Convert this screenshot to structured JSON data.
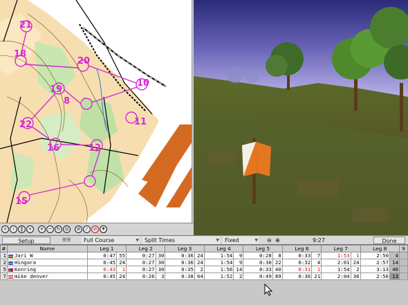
{
  "toolbar": {
    "setup_label": "Setup",
    "course_label": "Full Course",
    "split_label": "Split Times",
    "fixed_label": "Fixed",
    "time_display": "9:27",
    "done_label": "Done"
  },
  "map": {
    "control_labels": [
      "21",
      "18",
      "20",
      "10",
      "19",
      "8",
      "11",
      "22",
      "16",
      "12",
      "15"
    ]
  },
  "table": {
    "headers": [
      "#",
      "Name",
      "Leg 1",
      "Leg 2",
      "Leg 3",
      "Leg 4",
      "Leg 5",
      "Leg 6",
      "Leg 7",
      "Leg 8",
      "9"
    ],
    "rows": [
      {
        "rank": "1",
        "flag": "se",
        "name": "Jari W",
        "legs": [
          [
            "0:47",
            "55"
          ],
          [
            "0:27",
            "30"
          ],
          [
            "0:36",
            "24"
          ],
          [
            "1:54",
            "9"
          ],
          [
            "0:28",
            "8"
          ],
          [
            "0:33",
            "7"
          ],
          [
            "1:53",
            "1"
          ],
          [
            "2:50",
            "4"
          ]
        ]
      },
      {
        "rank": "2",
        "flag": "se",
        "name": "Hingara",
        "legs": [
          [
            "0:45",
            "24"
          ],
          [
            "0:27",
            "30"
          ],
          [
            "0:36",
            "24"
          ],
          [
            "1:54",
            "9"
          ],
          [
            "0:30",
            "22"
          ],
          [
            "0:32",
            "4"
          ],
          [
            "2:01",
            "24"
          ],
          [
            "2:57",
            "14"
          ]
        ]
      },
      {
        "rank": "5",
        "flag": "no",
        "name": "Konring",
        "legs": [
          [
            "0:43",
            "1"
          ],
          [
            "0:27",
            "30"
          ],
          [
            "0:35",
            "2"
          ],
          [
            "1:56",
            "14"
          ],
          [
            "0:33",
            "40"
          ],
          [
            "0:31",
            "1"
          ],
          [
            "1:54",
            "2"
          ],
          [
            "3:13",
            "40"
          ]
        ]
      },
      {
        "rank": "7",
        "flag": "us",
        "name": "mike denver",
        "legs": [
          [
            "0:45",
            "24"
          ],
          [
            "0:26",
            "3"
          ],
          [
            "0:38",
            "64"
          ],
          [
            "1:52",
            "2"
          ],
          [
            "0:49",
            "89"
          ],
          [
            "0:36",
            "21"
          ],
          [
            "2:04",
            "36"
          ],
          [
            "2:56",
            "13"
          ]
        ]
      }
    ]
  },
  "colors": {
    "red_time": "#cc1111",
    "control_marker": "#e4771f"
  }
}
